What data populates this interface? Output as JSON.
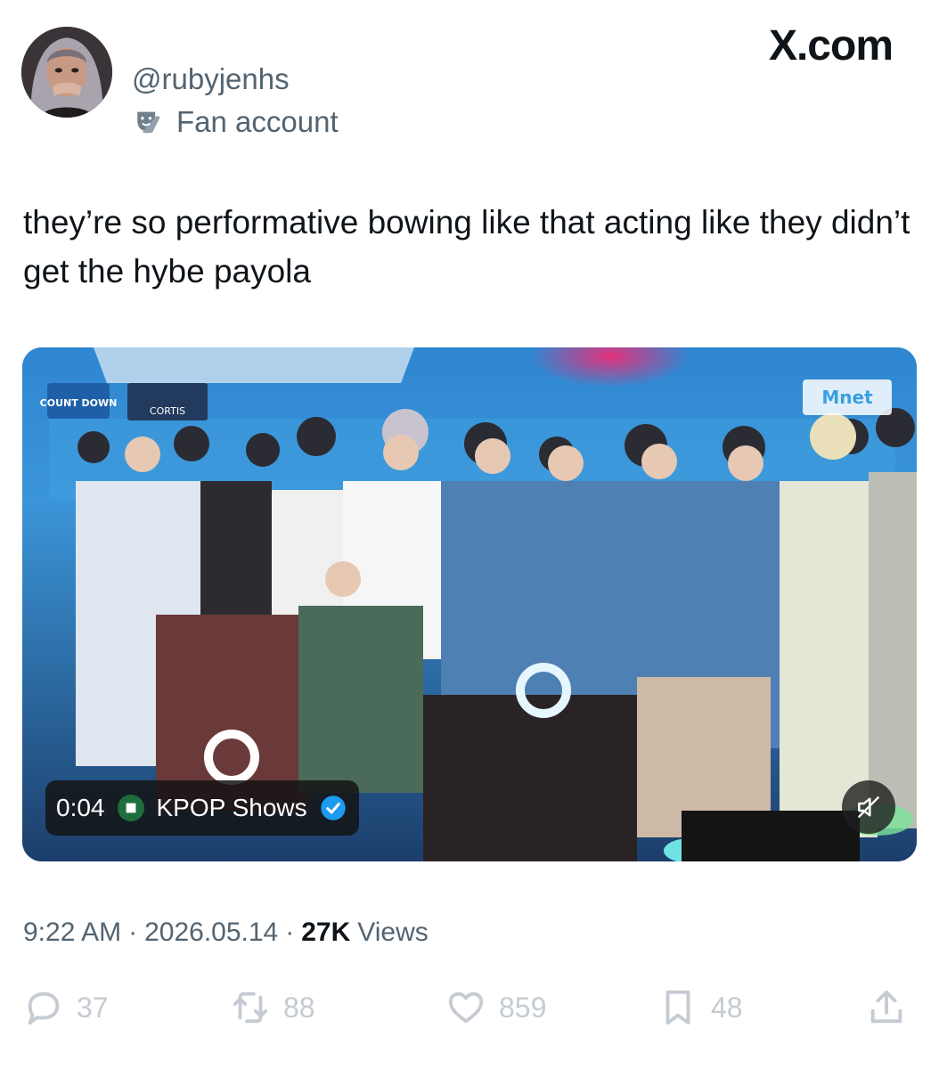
{
  "brand": "X.com",
  "author": {
    "handle": "@rubyjenhs",
    "badge_label": "Fan account",
    "badge_icon": "theater-mask-icon"
  },
  "tweet": {
    "text": "they’re so performative bowing like that acting like they didn’t get the hybe payola"
  },
  "media": {
    "type": "video",
    "timestamp": "0:04",
    "channel_name": "KPOP Shows",
    "channel_verified": true,
    "muted": true,
    "overlay_texts": {
      "show_tag": "COUNT DOWN",
      "winner_tag": "CORTIS",
      "broadcaster": "Mnet"
    }
  },
  "meta": {
    "time": "9:22 AM",
    "date": "2026.05.14",
    "separator": "·",
    "views_count": "27K",
    "views_label": "Views"
  },
  "actions": {
    "replies": "37",
    "reposts": "88",
    "likes": "859",
    "bookmarks": "48"
  },
  "colors": {
    "text_primary": "#0f1419",
    "text_secondary": "#536471",
    "action_gray": "#c5cbd2",
    "verified_blue": "#1d9bf0"
  }
}
